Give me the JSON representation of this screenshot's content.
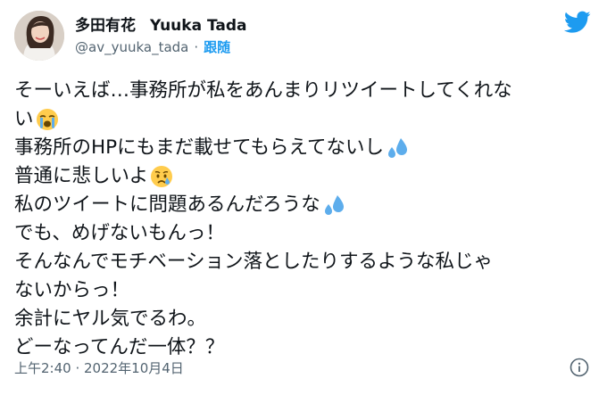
{
  "tweet": {
    "author": {
      "display_name": "多田有花",
      "display_name_en": "Yuuka Tada",
      "handle": "@av_yuuka_tada",
      "dot": "·",
      "follow_label": "跟随"
    },
    "lines": [
      "そーいえば…事務所が私をあんまりリツイートしてくれな",
      "い",
      "事務所のHPにもまだ載せてもらえてないし",
      "普通に悲しいよ",
      "私のツイートに問題あるんだろうな",
      "でも、めげないもんっ！",
      "そんなんでモチベーション落としたりするような私じゃ",
      "ないからっ！",
      "余計にヤル気でるわ。",
      "どーなってんだ一体？？"
    ],
    "emojis": {
      "line_1": "loudly-crying-face-emoji",
      "line_2": "sweat-droplets-emoji",
      "line_3": "crying-face-emoji",
      "line_4": "sweat-droplets-emoji"
    },
    "timestamp": "上午2:40 · 2022年10月4日"
  },
  "icons": {
    "bird": "twitter-bird-icon",
    "info": "info-icon"
  },
  "colors": {
    "brand_blue": "#1d9bf0",
    "secondary_text": "#536471",
    "primary_text": "#0f1419"
  }
}
